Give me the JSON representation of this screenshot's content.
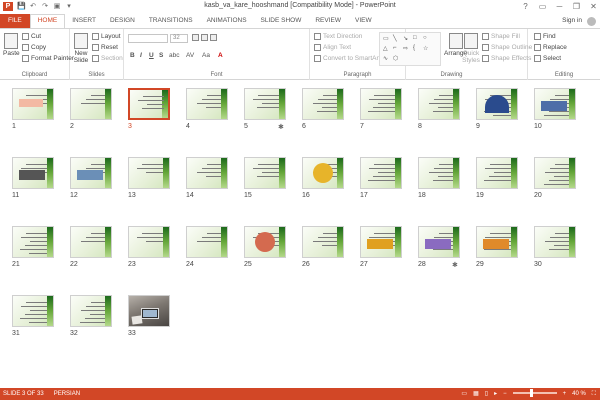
{
  "window": {
    "title": "kasb_va_kare_hooshmand [Compatibility Mode] - PowerPoint",
    "controls": [
      "?",
      "▭",
      "─",
      "❐",
      "✕"
    ]
  },
  "quick_access": [
    "P",
    "💾",
    "↶",
    "↷",
    "▣",
    "▾"
  ],
  "tabs": [
    "FILE",
    "HOME",
    "INSERT",
    "DESIGN",
    "TRANSITIONS",
    "ANIMATIONS",
    "SLIDE SHOW",
    "REVIEW",
    "VIEW"
  ],
  "active_tab": "HOME",
  "signin_label": "Sign in",
  "ribbon": {
    "clipboard": {
      "label": "Clipboard",
      "paste": "Paste",
      "cut": "Cut",
      "copy": "Copy",
      "format_painter": "Format Painter"
    },
    "slides": {
      "label": "Slides",
      "new_slide": "New Slide",
      "layout": "Layout",
      "reset": "Reset",
      "section": "Section"
    },
    "font": {
      "label": "Font",
      "font_size": "32"
    },
    "paragraph": {
      "label": "Paragraph",
      "text_direction": "Text Direction",
      "align_text": "Align Text",
      "convert_smartart": "Convert to SmartArt"
    },
    "drawing": {
      "label": "Drawing",
      "arrange": "Arrange",
      "quick_styles": "Quick Styles",
      "shape_fill": "Shape Fill",
      "shape_outline": "Shape Outline",
      "shape_effects": "Shape Effects"
    },
    "editing": {
      "label": "Editing",
      "find": "Find",
      "replace": "Replace",
      "select": "Select"
    }
  },
  "slides": {
    "total": 33,
    "selected": 3,
    "transition_marks": [
      5,
      28
    ],
    "labels": [
      "1",
      "2",
      "3",
      "4",
      "5",
      "6",
      "7",
      "8",
      "9",
      "10",
      "11",
      "12",
      "13",
      "14",
      "15",
      "16",
      "17",
      "18",
      "19",
      "20",
      "21",
      "22",
      "23",
      "24",
      "25",
      "26",
      "27",
      "28",
      "29",
      "30",
      "31",
      "32",
      "33"
    ],
    "star_glyph": "✱"
  },
  "status": {
    "slide_info": "SLIDE 3 OF 33",
    "language": "PERSIAN",
    "zoom": "40 %"
  }
}
